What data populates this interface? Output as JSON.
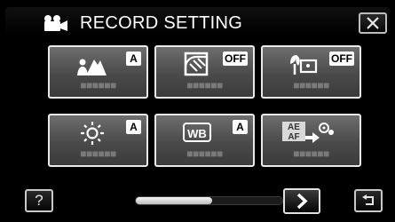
{
  "header": {
    "title": "RECORD SETTING",
    "title_icon": "video-camera-icon",
    "close_icon": "close-icon"
  },
  "tiles": [
    {
      "icon": "scene-select-icon",
      "badge": "A",
      "value": "■■■■■■"
    },
    {
      "icon": "backlight-compensation-icon",
      "badge": "OFF",
      "value": "■■■■■■"
    },
    {
      "icon": "tele-macro-icon",
      "badge": "OFF",
      "value": "■■■■■■"
    },
    {
      "icon": "brightness-adjust-icon",
      "badge": "A",
      "value": "■■■■■■"
    },
    {
      "icon": "white-balance-icon",
      "icon_text": "WB",
      "badge": "A",
      "value": "■■■■■■"
    },
    {
      "icon": "touch-priority-ae-af-icon",
      "icon_text": "AE\nAF",
      "value": "■■■■■■"
    }
  ],
  "footer": {
    "help_label": "?",
    "scroll_position": 0.52,
    "next_icon": "chevron-right-icon",
    "return_icon": "return-icon"
  },
  "colors": {
    "background": "#000000",
    "tile_top": "#6e6e6e",
    "tile_bottom": "#3b3b3b",
    "tile_border": "#e9e9e9",
    "text": "#ffffff"
  }
}
